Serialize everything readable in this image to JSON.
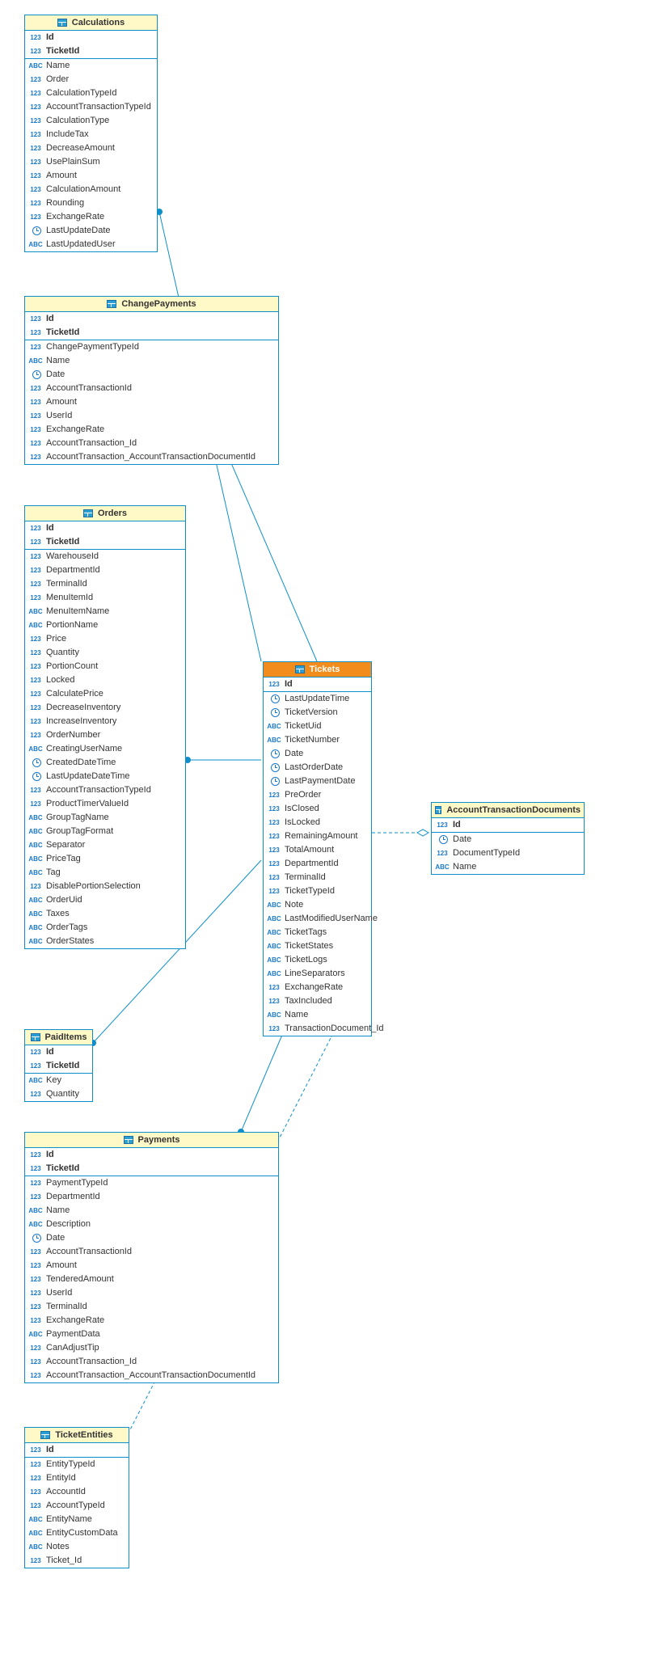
{
  "entities": {
    "calculations": {
      "title": "Calculations",
      "pk": [
        {
          "type": "pk",
          "label": "Id"
        },
        {
          "type": "123",
          "label": "TicketId"
        }
      ],
      "cols": [
        {
          "type": "abc",
          "label": "Name"
        },
        {
          "type": "123",
          "label": "Order"
        },
        {
          "type": "123",
          "label": "CalculationTypeId"
        },
        {
          "type": "123",
          "label": "AccountTransactionTypeId"
        },
        {
          "type": "123",
          "label": "CalculationType"
        },
        {
          "type": "123",
          "label": "IncludeTax"
        },
        {
          "type": "123",
          "label": "DecreaseAmount"
        },
        {
          "type": "123",
          "label": "UsePlainSum"
        },
        {
          "type": "123",
          "label": "Amount"
        },
        {
          "type": "123",
          "label": "CalculationAmount"
        },
        {
          "type": "123",
          "label": "Rounding"
        },
        {
          "type": "123",
          "label": "ExchangeRate"
        },
        {
          "type": "clock",
          "label": "LastUpdateDate"
        },
        {
          "type": "abc",
          "label": "LastUpdatedUser"
        }
      ]
    },
    "changePayments": {
      "title": "ChangePayments",
      "pk": [
        {
          "type": "pk",
          "label": "Id"
        },
        {
          "type": "123",
          "label": "TicketId"
        }
      ],
      "cols": [
        {
          "type": "123",
          "label": "ChangePaymentTypeId"
        },
        {
          "type": "abc",
          "label": "Name"
        },
        {
          "type": "clock",
          "label": "Date"
        },
        {
          "type": "123",
          "label": "AccountTransactionId"
        },
        {
          "type": "123",
          "label": "Amount"
        },
        {
          "type": "123",
          "label": "UserId"
        },
        {
          "type": "123",
          "label": "ExchangeRate"
        },
        {
          "type": "123",
          "label": "AccountTransaction_Id"
        },
        {
          "type": "123",
          "label": "AccountTransaction_AccountTransactionDocumentId"
        }
      ]
    },
    "orders": {
      "title": "Orders",
      "pk": [
        {
          "type": "pk",
          "label": "Id"
        },
        {
          "type": "123",
          "label": "TicketId"
        }
      ],
      "cols": [
        {
          "type": "123",
          "label": "WarehouseId"
        },
        {
          "type": "123",
          "label": "DepartmentId"
        },
        {
          "type": "123",
          "label": "TerminalId"
        },
        {
          "type": "123",
          "label": "MenuItemId"
        },
        {
          "type": "abc",
          "label": "MenuItemName"
        },
        {
          "type": "abc",
          "label": "PortionName"
        },
        {
          "type": "123",
          "label": "Price"
        },
        {
          "type": "123",
          "label": "Quantity"
        },
        {
          "type": "123",
          "label": "PortionCount"
        },
        {
          "type": "123",
          "label": "Locked"
        },
        {
          "type": "123",
          "label": "CalculatePrice"
        },
        {
          "type": "123",
          "label": "DecreaseInventory"
        },
        {
          "type": "123",
          "label": "IncreaseInventory"
        },
        {
          "type": "123",
          "label": "OrderNumber"
        },
        {
          "type": "abc",
          "label": "CreatingUserName"
        },
        {
          "type": "clock",
          "label": "CreatedDateTime"
        },
        {
          "type": "clock",
          "label": "LastUpdateDateTime"
        },
        {
          "type": "123",
          "label": "AccountTransactionTypeId"
        },
        {
          "type": "123",
          "label": "ProductTimerValueId"
        },
        {
          "type": "abc",
          "label": "GroupTagName"
        },
        {
          "type": "abc",
          "label": "GroupTagFormat"
        },
        {
          "type": "abc",
          "label": "Separator"
        },
        {
          "type": "abc",
          "label": "PriceTag"
        },
        {
          "type": "abc",
          "label": "Tag"
        },
        {
          "type": "123",
          "label": "DisablePortionSelection"
        },
        {
          "type": "abc",
          "label": "OrderUid"
        },
        {
          "type": "abc",
          "label": "Taxes"
        },
        {
          "type": "abc",
          "label": "OrderTags"
        },
        {
          "type": "abc",
          "label": "OrderStates"
        }
      ]
    },
    "paidItems": {
      "title": "PaidItems",
      "pk": [
        {
          "type": "pk",
          "label": "Id"
        },
        {
          "type": "123",
          "label": "TicketId"
        }
      ],
      "cols": [
        {
          "type": "abc",
          "label": "Key"
        },
        {
          "type": "123",
          "label": "Quantity"
        }
      ]
    },
    "payments": {
      "title": "Payments",
      "pk": [
        {
          "type": "pk",
          "label": "Id"
        },
        {
          "type": "123",
          "label": "TicketId"
        }
      ],
      "cols": [
        {
          "type": "123",
          "label": "PaymentTypeId"
        },
        {
          "type": "123",
          "label": "DepartmentId"
        },
        {
          "type": "abc",
          "label": "Name"
        },
        {
          "type": "abc",
          "label": "Description"
        },
        {
          "type": "clock",
          "label": "Date"
        },
        {
          "type": "123",
          "label": "AccountTransactionId"
        },
        {
          "type": "123",
          "label": "Amount"
        },
        {
          "type": "123",
          "label": "TenderedAmount"
        },
        {
          "type": "123",
          "label": "UserId"
        },
        {
          "type": "123",
          "label": "TerminalId"
        },
        {
          "type": "123",
          "label": "ExchangeRate"
        },
        {
          "type": "abc",
          "label": "PaymentData"
        },
        {
          "type": "123",
          "label": "CanAdjustTip"
        },
        {
          "type": "123",
          "label": "AccountTransaction_Id"
        },
        {
          "type": "123",
          "label": "AccountTransaction_AccountTransactionDocumentId"
        }
      ]
    },
    "ticketEntities": {
      "title": "TicketEntities",
      "pk": [
        {
          "type": "pk",
          "label": "Id"
        }
      ],
      "cols": [
        {
          "type": "123",
          "label": "EntityTypeId"
        },
        {
          "type": "123",
          "label": "EntityId"
        },
        {
          "type": "123",
          "label": "AccountId"
        },
        {
          "type": "123",
          "label": "AccountTypeId"
        },
        {
          "type": "abc",
          "label": "EntityName"
        },
        {
          "type": "abc",
          "label": "EntityCustomData"
        },
        {
          "type": "abc",
          "label": "Notes"
        },
        {
          "type": "123",
          "label": "Ticket_Id"
        }
      ]
    },
    "tickets": {
      "title": "Tickets",
      "highlight": true,
      "pk": [
        {
          "type": "pk",
          "label": "Id"
        }
      ],
      "cols": [
        {
          "type": "clock",
          "label": "LastUpdateTime"
        },
        {
          "type": "clock",
          "label": "TicketVersion"
        },
        {
          "type": "abc",
          "label": "TicketUid"
        },
        {
          "type": "abc",
          "label": "TicketNumber"
        },
        {
          "type": "clock",
          "label": "Date"
        },
        {
          "type": "clock",
          "label": "LastOrderDate"
        },
        {
          "type": "clock",
          "label": "LastPaymentDate"
        },
        {
          "type": "123",
          "label": "PreOrder"
        },
        {
          "type": "123",
          "label": "IsClosed"
        },
        {
          "type": "123",
          "label": "IsLocked"
        },
        {
          "type": "123",
          "label": "RemainingAmount"
        },
        {
          "type": "123",
          "label": "TotalAmount"
        },
        {
          "type": "123",
          "label": "DepartmentId"
        },
        {
          "type": "123",
          "label": "TerminalId"
        },
        {
          "type": "123",
          "label": "TicketTypeId"
        },
        {
          "type": "abc",
          "label": "Note"
        },
        {
          "type": "abc",
          "label": "LastModifiedUserName"
        },
        {
          "type": "abc",
          "label": "TicketTags"
        },
        {
          "type": "abc",
          "label": "TicketStates"
        },
        {
          "type": "abc",
          "label": "TicketLogs"
        },
        {
          "type": "abc",
          "label": "LineSeparators"
        },
        {
          "type": "123",
          "label": "ExchangeRate"
        },
        {
          "type": "123",
          "label": "TaxIncluded"
        },
        {
          "type": "abc",
          "label": "Name"
        },
        {
          "type": "123",
          "label": "TransactionDocument_Id"
        }
      ]
    },
    "accountTransactionDocuments": {
      "title": "AccountTransactionDocuments",
      "pk": [
        {
          "type": "pk",
          "label": "Id"
        }
      ],
      "cols": [
        {
          "type": "clock",
          "label": "Date"
        },
        {
          "type": "123",
          "label": "DocumentTypeId"
        },
        {
          "type": "abc",
          "label": "Name"
        }
      ]
    }
  }
}
